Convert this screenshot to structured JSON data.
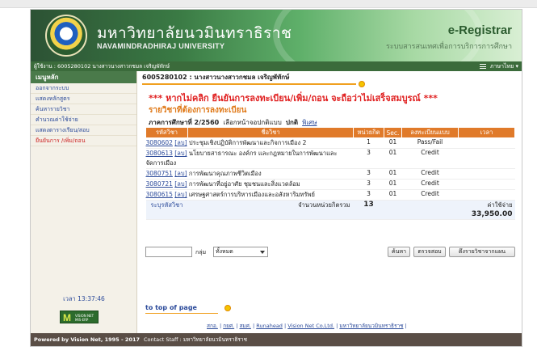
{
  "banner": {
    "university_th": "มหาวิทยาลัยนวมินทราธิราช",
    "university_en": "NAVAMINDRADHIRAJ UNIVERSITY",
    "system_name": "e-Registrar",
    "system_sub": "ระบบสารสนเทศเพื่อการบริการการศึกษา"
  },
  "userbar": {
    "user_text": "ผู้ใช้งาน : 6005280102 นางสาวนางสาวกชมล เจริญพัทักษ์",
    "language_label": "ภาษาไทย"
  },
  "sidebar": {
    "header": "เมนูหลัก",
    "items": [
      "ออกจากระบบ",
      "แสดงหลักสูตร",
      "ค้นหารายวิชา",
      "คำนวณค่าใช้จ่าย",
      "แสดงตารางเรียน/สอบ",
      "ยืนยันการ /เพิ่ม/ถอน"
    ],
    "time": "เวลา 13:37:46",
    "badge_letter": "M",
    "badge_text": "VISION NET MIS-ERP"
  },
  "content": {
    "student": "6005280102 : นางสาวนางสาวกชมล เจริญพัทักษ์",
    "warning": "*** หากไม่คลิก ยืนยันการลงทะเบียน/เพิ่ม/ถอน จะถือว่าไม่เสร็จสมบูรณ์ ***",
    "subtitle": "รายวิชาที่ต้องการลงทะเบียน",
    "term_label": "ภาคการศึกษาที่ 2/2560",
    "term_choose": "เลือกหน้าจอปกติแบบ",
    "term_normal": "ปกติ",
    "term_special": "พิเศษ"
  },
  "table": {
    "headers": [
      "รหัสวิชา",
      "ชื่อวิชา",
      "หน่วยกิต",
      "Sec.",
      "ลงทะเบียนแบบ",
      "เวลา"
    ],
    "rows": [
      {
        "code": "3080602",
        "link": "[ลบ]",
        "name": "ประชุมเชิงปฏิบัติการพัฒนาและกิจการเมือง 2",
        "credit": "1",
        "sec": "01",
        "type": "Pass/Fail"
      },
      {
        "code": "3080613",
        "link": "[ลบ]",
        "name": "นโยบายสาธารณะ องค์กร และกฎหมายในการพัฒนาและจัดการเมือง",
        "credit": "3",
        "sec": "01",
        "type": "Credit"
      },
      {
        "code": "3080751",
        "link": "[ลบ]",
        "name": "การพัฒนาคุณภาพชีวิตเมือง",
        "credit": "3",
        "sec": "01",
        "type": "Credit"
      },
      {
        "code": "3080721",
        "link": "[ลบ]",
        "name": "การพัฒนาที่อยู่อาศัย ชุมชนและสิ่งแวดล้อม",
        "credit": "3",
        "sec": "01",
        "type": "Credit"
      },
      {
        "code": "3080615",
        "link": "[ลบ]",
        "name": "เศรษฐศาสตร์การบริหารเมืองและอสังหาริมทรัพย์",
        "credit": "3",
        "sec": "01",
        "type": "Credit"
      }
    ],
    "footer_code_label": "ระบุรหัสวิชา",
    "total_label": "จำนวนหน่วยกิตรวม",
    "total_credits": "13",
    "fee_label": "ค่าใช้จ่าย",
    "fee_value": "33,950.00"
  },
  "search": {
    "group_label": "กลุ่ม",
    "group_value": "ทั้งหมด",
    "btn_search": "ค้นหา",
    "btn_check": "ตรวจสอบ",
    "btn_plan": "ดึงรายวิชาจากแผน"
  },
  "bottom": {
    "to_top": "to top of page",
    "links": [
      "สกอ.",
      "กยศ.",
      "สมศ.",
      "Runahead",
      "Vision Net Co.Ltd.",
      "มหาวิทยาลัยนวมินทราธิราช"
    ]
  },
  "footer": {
    "powered": "Powered by Vision Net, 1995 - 2017",
    "contact": "Contact Staff : มหาวิทยาลัยนวมินทราธิราช"
  }
}
